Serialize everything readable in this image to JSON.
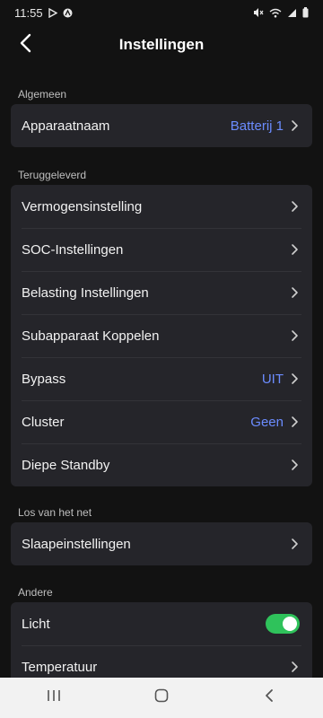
{
  "status_bar": {
    "time": "11:55",
    "icons": [
      "play-store-icon",
      "app-icon",
      "mute-icon",
      "wifi-icon",
      "signal-icon",
      "battery-icon"
    ]
  },
  "header": {
    "title": "Instellingen",
    "back_icon": "chevron-left-icon"
  },
  "sections": {
    "algemeen": {
      "label": "Algemeen",
      "items": [
        {
          "label": "Apparaatnaam",
          "value": "Batterij 1"
        }
      ]
    },
    "teruggeleverd": {
      "label": "Teruggeleverd",
      "items": [
        {
          "label": "Vermogensinstelling",
          "value": ""
        },
        {
          "label": "SOC-Instellingen",
          "value": ""
        },
        {
          "label": "Belasting Instellingen",
          "value": ""
        },
        {
          "label": "Subapparaat Koppelen",
          "value": ""
        },
        {
          "label": "Bypass",
          "value": "UIT"
        },
        {
          "label": "Cluster",
          "value": "Geen"
        },
        {
          "label": "Diepe Standby",
          "value": ""
        }
      ]
    },
    "los_van_het_net": {
      "label": "Los van het net",
      "items": [
        {
          "label": "Slaapeinstellingen",
          "value": ""
        }
      ]
    },
    "andere": {
      "label": "Andere",
      "items": [
        {
          "label": "Licht",
          "toggle": true
        },
        {
          "label": "Temperatuur",
          "value": ""
        }
      ]
    }
  },
  "colors": {
    "background": "#121212",
    "card": "#25252a",
    "accent_value": "#6b8cff",
    "toggle_on": "#2fc25b",
    "nav_bar": "#f2f2f2"
  },
  "nav_bar": {
    "icons": [
      "recent-apps-icon",
      "home-icon",
      "back-icon"
    ]
  }
}
